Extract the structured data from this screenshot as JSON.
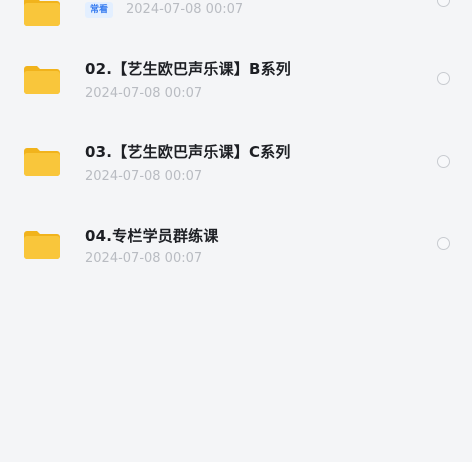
{
  "files": [
    {
      "name": "",
      "badge": "常看",
      "date": "2024-07-08 00:07"
    },
    {
      "name": "02.【艺生欧巴声乐课】B系列",
      "date": "2024-07-08 00:07"
    },
    {
      "name": "03.【艺生欧巴声乐课】C系列",
      "date": "2024-07-08 00:07"
    },
    {
      "name": "04.专栏学员群练课",
      "date": "2024-07-08 00:07"
    }
  ],
  "icons": {
    "folder": "folder-icon",
    "select": "radio-circle-icon"
  },
  "colors": {
    "folder_yellow": "#f9c63b",
    "badge_bg": "#e3efff",
    "badge_text": "#3a7ef0",
    "background": "#f4f5f7"
  }
}
